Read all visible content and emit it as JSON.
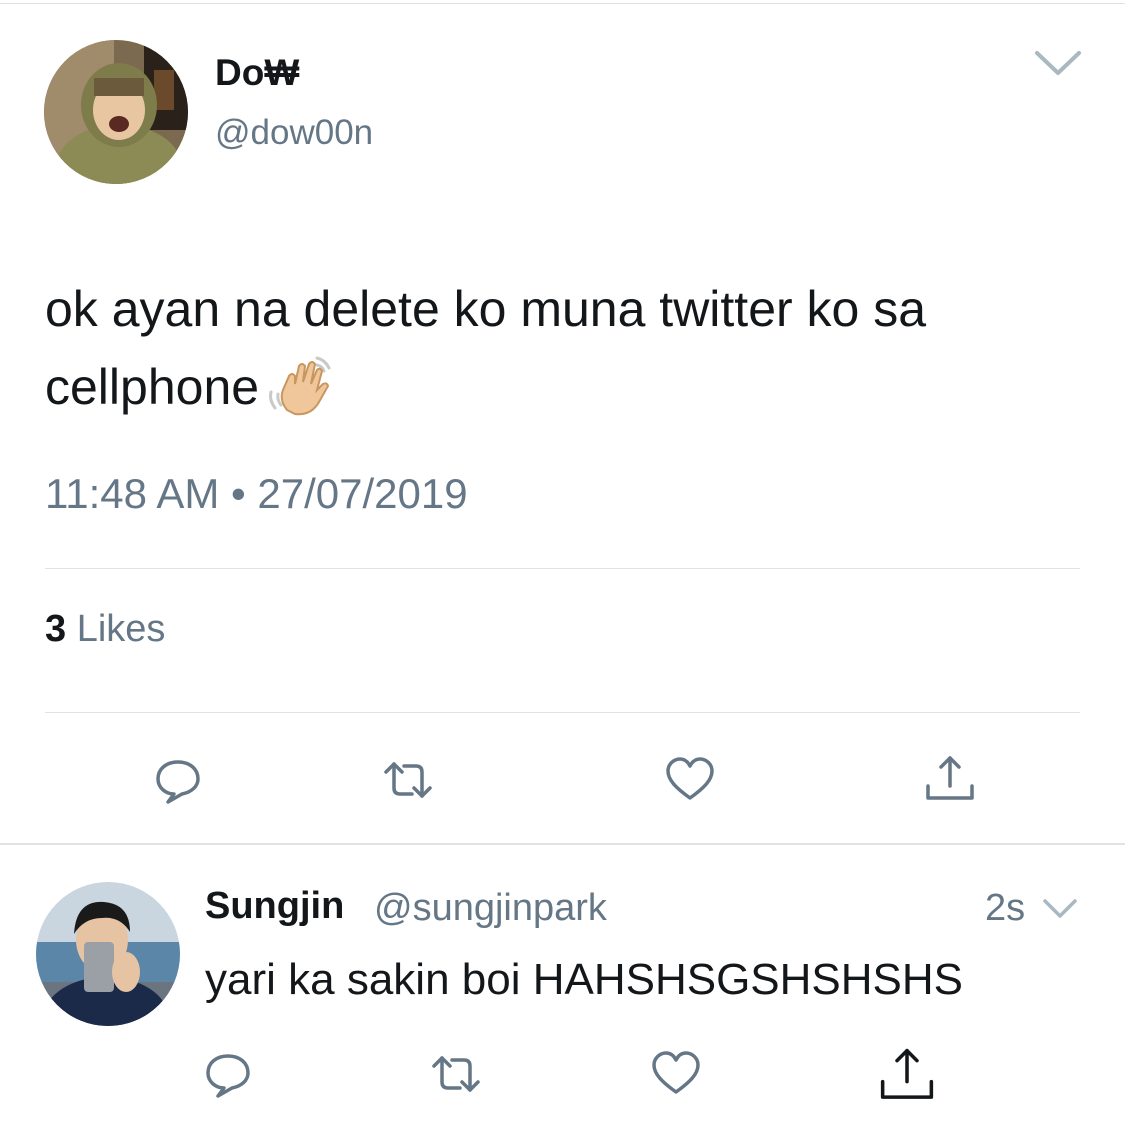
{
  "tweet": {
    "author_name": "Do₩",
    "author_handle": "@dow00n",
    "text": "ok ayan na delete ko muna twitter ko sa cellphone",
    "emoji": "waving-hand-emoji",
    "timestamp": "11:48 AM • 27/07/2019",
    "likes_count": "3",
    "likes_label": "Likes"
  },
  "reply": {
    "author_name": "Sungjin",
    "author_handle": "@sungjinpark",
    "time": "2s",
    "text": "yari ka sakin boi HAHSHSGSHSHSHS"
  },
  "icons": [
    "reply-icon",
    "retweet-icon",
    "like-icon",
    "share-icon",
    "chevron-down-icon"
  ],
  "colors": {
    "text": "#14171a",
    "secondary": "#657786",
    "divider": "#dfe3e6"
  }
}
